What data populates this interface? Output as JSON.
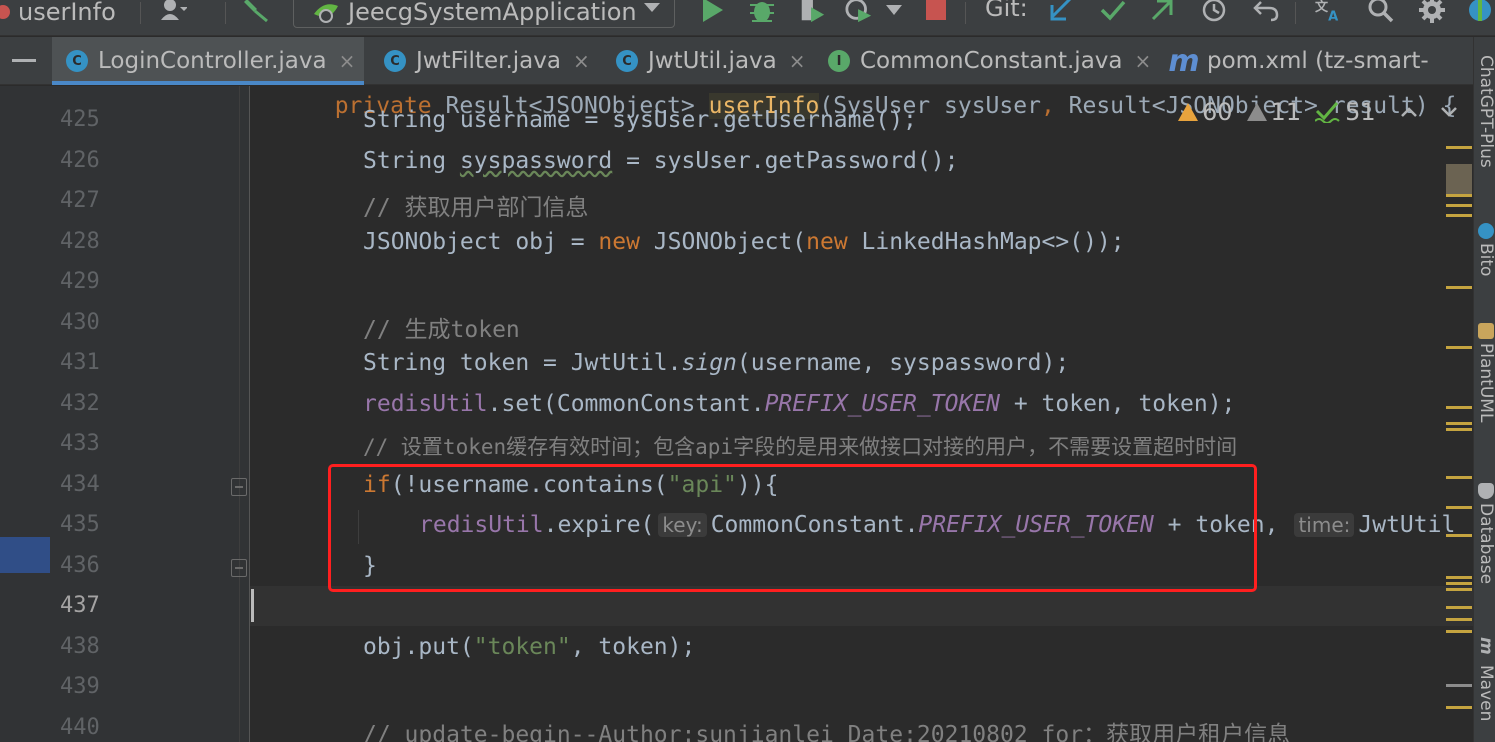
{
  "toolbar": {
    "project_name": "userInfo",
    "run_config": "JeecgSystemApplication",
    "git_label": "Git:"
  },
  "tabs": [
    {
      "label": "LoginController.java",
      "icon": "class-icon",
      "active": true
    },
    {
      "label": "JwtFilter.java",
      "icon": "class-icon",
      "active": false
    },
    {
      "label": "JwtUtil.java",
      "icon": "class-icon",
      "active": false
    },
    {
      "label": "CommonConstant.java",
      "icon": "interface-icon",
      "active": false
    },
    {
      "label": "pom.xml (tz-smart-",
      "icon": "maven-icon",
      "active": false
    }
  ],
  "icon_letters": {
    "class": "C",
    "interface": "I",
    "maven": "m",
    "close": "×"
  },
  "inspection": {
    "warnings": "60",
    "weak_warnings": "11",
    "typos": "51"
  },
  "editor": {
    "line_numbers": [
      "425",
      "426",
      "427",
      "428",
      "429",
      "430",
      "431",
      "432",
      "433",
      "434",
      "435",
      "436",
      "437",
      "438",
      "439",
      "440"
    ],
    "current_line": "437",
    "top_partial_line": "private Result<JSONObject> userInfo(SysUser sysUser, Result<JSONObject> result) {",
    "hints": {
      "key": "key:",
      "time": "time:"
    },
    "lines": {
      "l425": "String username = sysUser.getUsername();",
      "l426_a": "String ",
      "l426_b": "syspassword",
      "l426_c": " = sysUser.getPassword();",
      "l427": "// 获取用户部门信息",
      "l428_a": "JSONObject obj = ",
      "l428_new1": "new",
      "l428_b": " JSONObject(",
      "l428_new2": "new",
      "l428_c": " LinkedHashMap<>());",
      "l430": "// 生成token",
      "l431_a": "String token = JwtUtil.",
      "l431_sign": "sign",
      "l431_b": "(username, syspassword);",
      "l432_field": "redisUtil",
      "l432_a": ".set(CommonConstant.",
      "l432_const": "PREFIX_USER_TOKEN",
      "l432_b": " + token, token);",
      "l433": "// 设置token缓存有效时间；包含api字段的是用来做接口对接的用户，不需要设置超时时间",
      "l434_if": "if",
      "l434_a": "(!username.contains(",
      "l434_str": "\"api\"",
      "l434_b": ")){",
      "l435_field": "redisUtil",
      "l435_a": ".expire(",
      "l435_b": "CommonConstant.",
      "l435_const": "PREFIX_USER_TOKEN",
      "l435_c": " + token,",
      "l435_d": "JwtUtil",
      "l436": "}",
      "l438_a": "obj.put(",
      "l438_str": "\"token\"",
      "l438_b": ", token);",
      "l440_a": "// update-begin--Author:",
      "l440_b": "sunjianlei",
      "l440_c": " Date:20210802 for：获取用户租户信息"
    }
  },
  "right_tool_windows": [
    "ChatGPT-Plus",
    "Bito",
    "PlantUML",
    "Database",
    "Maven"
  ],
  "colors": {
    "keyword": "#cc7832",
    "string": "#6a8759",
    "comment": "#808080",
    "field": "#9876aa",
    "highlight_box": "#ff1f1f",
    "background": "#2b2b2b"
  }
}
